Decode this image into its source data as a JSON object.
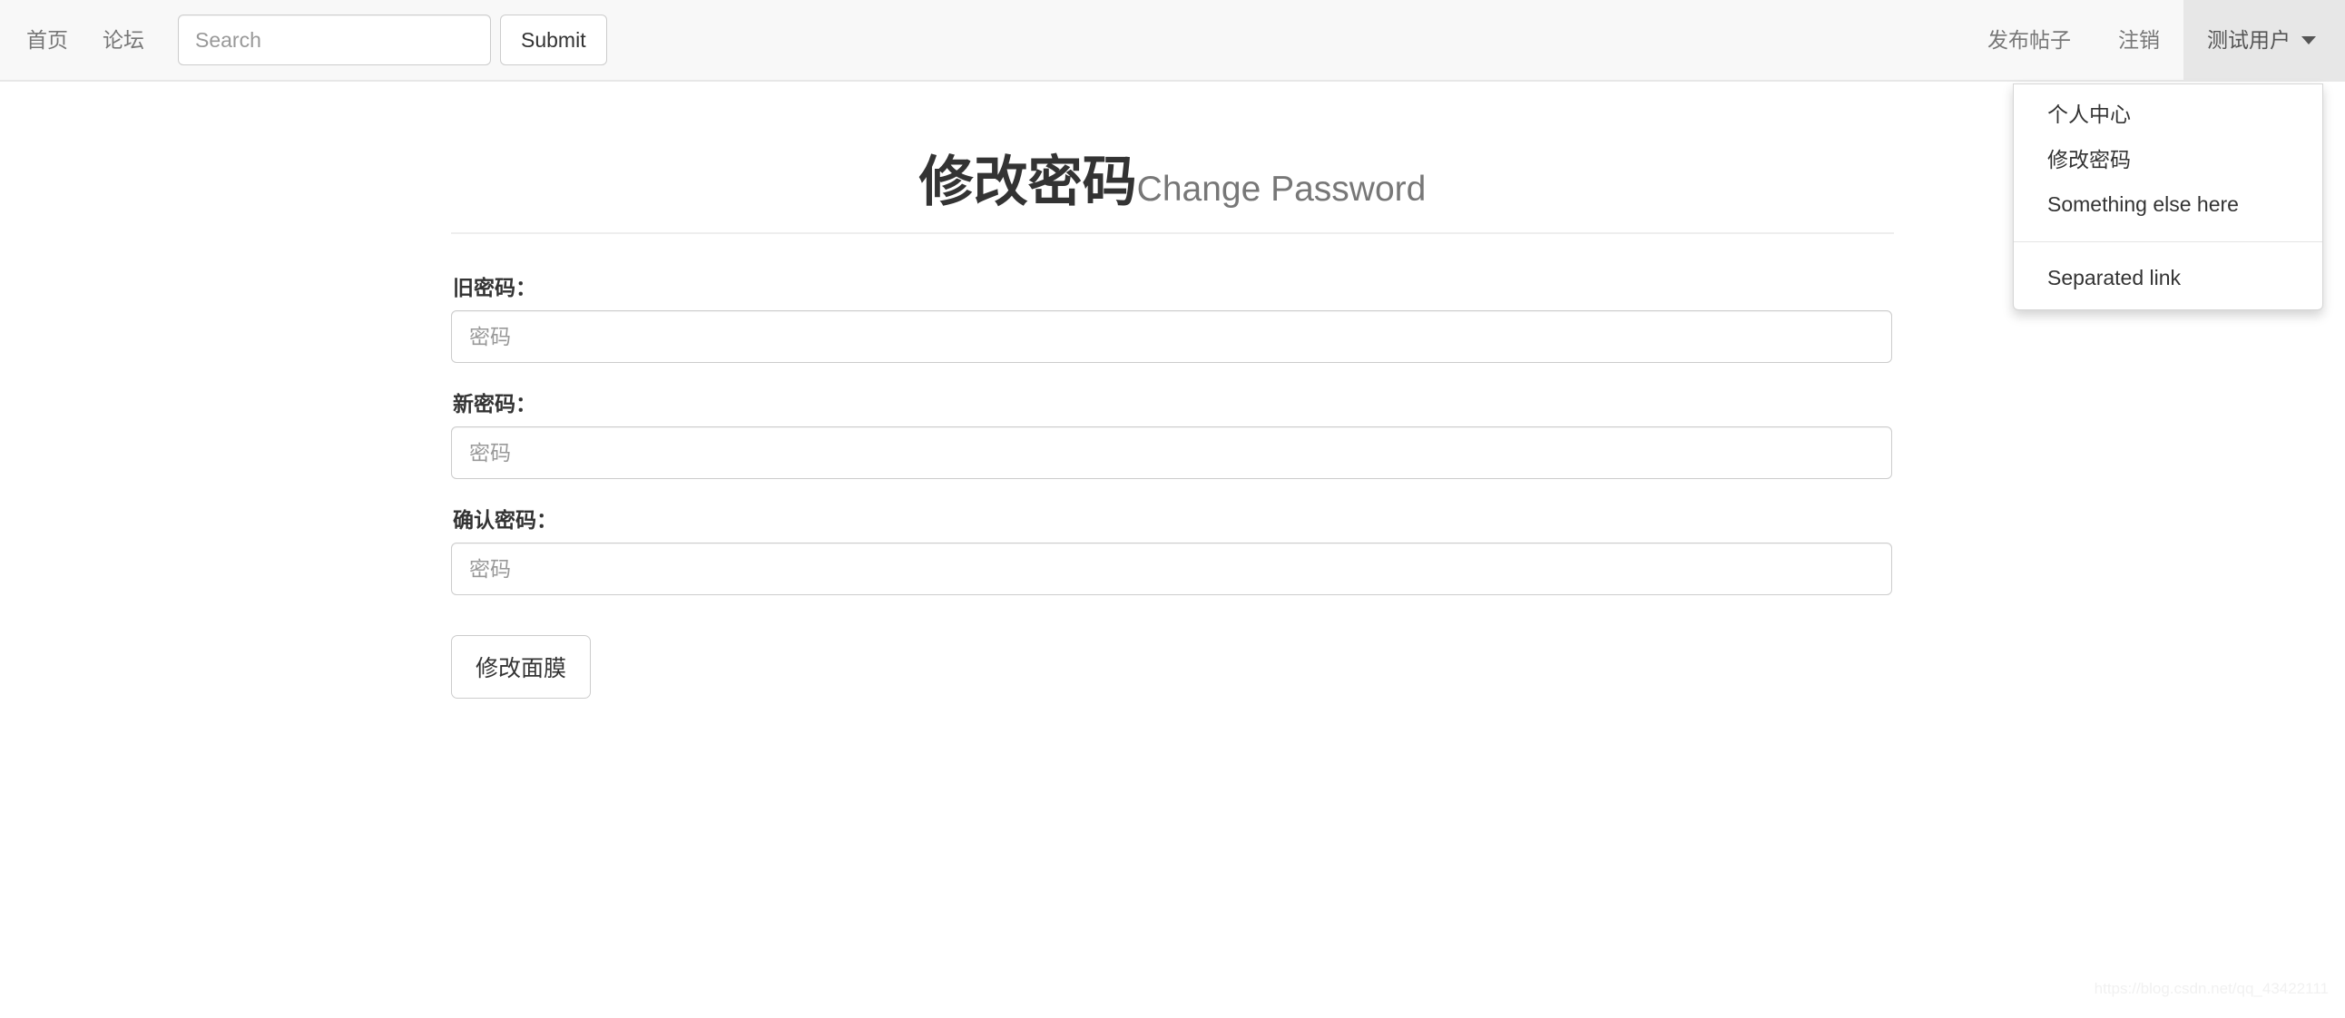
{
  "navbar": {
    "left_links": [
      {
        "label": "首页",
        "name": "nav-link-home"
      },
      {
        "label": "论坛",
        "name": "nav-link-forum"
      }
    ],
    "search": {
      "placeholder": "Search",
      "value": "",
      "submit_label": "Submit"
    },
    "right_links": [
      {
        "label": "发布帖子",
        "name": "nav-link-new-post"
      },
      {
        "label": "注销",
        "name": "nav-link-logout"
      }
    ],
    "user_menu": {
      "label": "测试用户",
      "caret_icon": "chevron-down-icon",
      "active_background": "#e7e7e7",
      "items": [
        {
          "label": "个人中心",
          "name": "dropdown-item-profile"
        },
        {
          "label": "修改密码",
          "name": "dropdown-item-change-password"
        },
        {
          "label": "Something else here",
          "name": "dropdown-item-something-else"
        },
        {
          "label": "Separated link",
          "name": "dropdown-item-separated-link",
          "after_divider": true
        }
      ]
    }
  },
  "page": {
    "title": "修改密码",
    "subtitle": "Change Password"
  },
  "form": {
    "fields": [
      {
        "label": "旧密码：",
        "placeholder": "密码",
        "value": "",
        "name": "old-password-field"
      },
      {
        "label": "新密码：",
        "placeholder": "密码",
        "value": "",
        "name": "new-password-field"
      },
      {
        "label": "确认密码：",
        "placeholder": "密码",
        "value": "",
        "name": "confirm-password-field"
      }
    ],
    "submit_label": "修改面膜"
  },
  "watermark": "https://blog.csdn.net/qq_43422111",
  "colors": {
    "navbar_background": "#f8f8f8",
    "navbar_border": "#e7e7e7",
    "nav_link_text": "#777777",
    "body_text": "#333333",
    "muted_text": "#777777",
    "input_border": "#cccccc",
    "placeholder_text": "#999999"
  }
}
